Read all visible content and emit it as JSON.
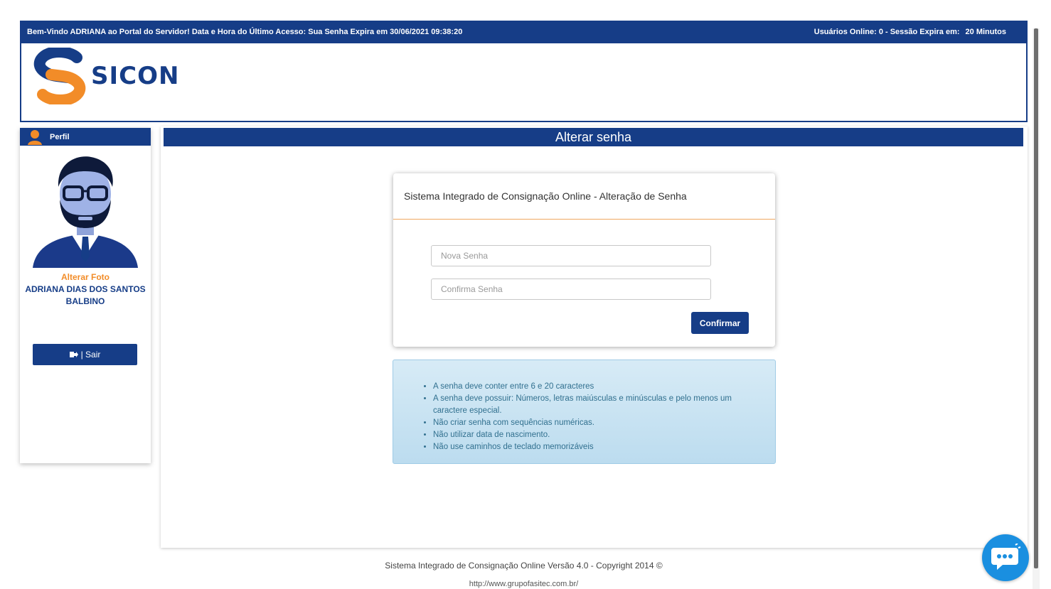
{
  "topbar": {
    "welcome": "Bem-Vindo ADRIANA ao Portal do Servidor! Data e Hora do Último Acesso: Sua Senha Expira em 30/06/2021 09:38:20",
    "online_users": "Usuários Online: 0 - Sessão Expira em:",
    "session_time": "20 Minutos"
  },
  "brand": {
    "name": "SICON",
    "primary_color": "#163d87",
    "accent_color": "#f28c28"
  },
  "sidebar": {
    "header": "Perfil",
    "change_photo": "Alterar Foto",
    "user_name": "ADRIANA DIAS DOS SANTOS BALBINO",
    "logout_label": "| Sair",
    "logout_icon": "sign-out-icon"
  },
  "main": {
    "title": "Alterar senha",
    "card_title": "Sistema Integrado de Consignação Online - Alteração de Senha",
    "new_password_placeholder": "Nova Senha",
    "confirm_password_placeholder": "Confirma Senha",
    "confirm_button": "Confirmar",
    "rules": [
      "A senha deve conter entre 6 e 20 caracteres",
      "A senha deve possuir: Números, letras maiúsculas e minúsculas e pelo menos um caractere especial.",
      "Não criar senha com sequências numéricas.",
      "Não utilizar data de nascimento.",
      "Não use caminhos de teclado memorizáveis"
    ]
  },
  "footer": {
    "copyright": "Sistema Integrado de Consignação Online Versão 4.0 - Copyright 2014 ©",
    "url": "http://www.grupofasitec.com.br/"
  },
  "chat": {
    "icon": "chat-bubble-icon"
  }
}
